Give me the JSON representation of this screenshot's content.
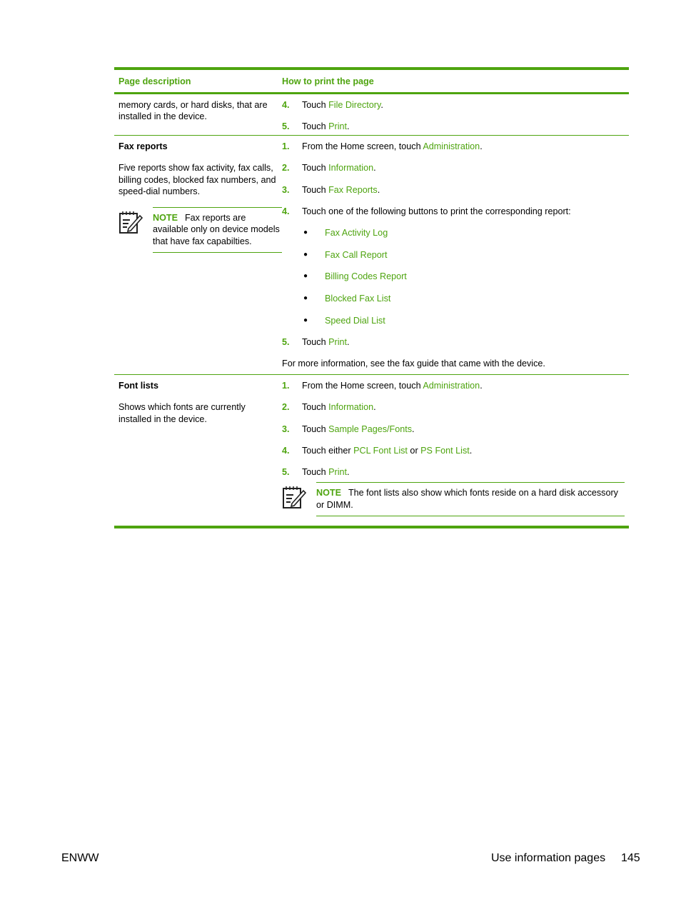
{
  "table": {
    "headers": [
      "Page description",
      "How to print the page"
    ],
    "rows": [
      {
        "description": {
          "title": "",
          "text": "memory cards, or hard disks, that are installed in the device."
        },
        "steps": [
          {
            "num": "4.",
            "prefix": "Touch ",
            "link": "File Directory",
            "suffix": "."
          },
          {
            "num": "5.",
            "prefix": "Touch ",
            "link": "Print",
            "suffix": "."
          }
        ]
      },
      {
        "description": {
          "title": "Fax reports",
          "text": "Five reports show fax activity, fax calls, billing codes, blocked fax numbers, and speed-dial numbers.",
          "note": {
            "label": "NOTE",
            "text": "Fax reports are available only on device models that have fax capabilties."
          }
        },
        "steps": [
          {
            "num": "1.",
            "prefix": "From the Home screen, touch ",
            "link": "Administration",
            "suffix": "."
          },
          {
            "num": "2.",
            "prefix": "Touch ",
            "link": "Information",
            "suffix": "."
          },
          {
            "num": "3.",
            "prefix": "Touch ",
            "link": "Fax Reports",
            "suffix": "."
          },
          {
            "num": "4.",
            "prefix": "Touch one of the following buttons to print the corresponding report:",
            "link": "",
            "suffix": ""
          },
          {
            "num": "5.",
            "prefix": "Touch ",
            "link": "Print",
            "suffix": "."
          }
        ],
        "bullets": [
          "Fax Activity Log",
          "Fax Call Report",
          "Billing Codes Report",
          "Blocked Fax List",
          "Speed Dial List"
        ],
        "footnote": "For more information, see the fax guide that came with the device."
      },
      {
        "description": {
          "title": "Font lists",
          "text": "Shows which fonts are currently installed in the device."
        },
        "steps": [
          {
            "num": "1.",
            "prefix": "From the Home screen, touch ",
            "link": "Administration",
            "suffix": "."
          },
          {
            "num": "2.",
            "prefix": "Touch ",
            "link": "Information",
            "suffix": "."
          },
          {
            "num": "3.",
            "prefix": "Touch ",
            "link": "Sample Pages/Fonts",
            "suffix": "."
          },
          {
            "num": "4.",
            "prefix": "Touch either ",
            "link": "PCL Font List",
            "mid": " or ",
            "link2": "PS Font List",
            "suffix": "."
          },
          {
            "num": "5.",
            "prefix": "Touch ",
            "link": "Print",
            "suffix": "."
          }
        ],
        "note": {
          "label": "NOTE",
          "text": "The font lists also show which fonts reside on a hard disk accessory or DIMM."
        }
      }
    ]
  },
  "footer": {
    "left": "ENWW",
    "section": "Use information pages",
    "page_number": "145"
  },
  "colors": {
    "accent": "#4ea40f"
  }
}
